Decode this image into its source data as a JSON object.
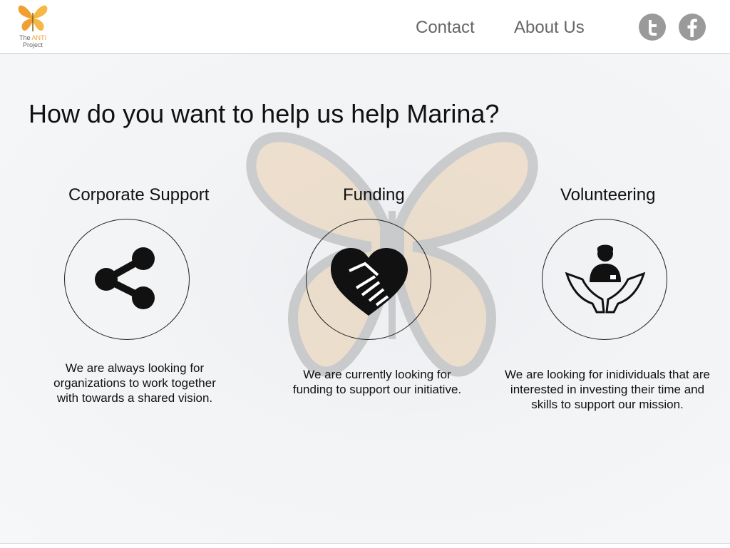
{
  "header": {
    "logo": {
      "line1_prefix": "The ",
      "line1_accent": "ANTI",
      "line2": "Project",
      "accent_color": "#f0a030"
    },
    "nav": [
      {
        "label": "Contact"
      },
      {
        "label": "About Us"
      }
    ],
    "social": [
      {
        "icon": "twitter-icon",
        "color": "#9a9a9a"
      },
      {
        "icon": "facebook-icon",
        "color": "#9a9a9a"
      }
    ]
  },
  "main": {
    "title": "How do you want to help us help Marina?",
    "cards": [
      {
        "title": "Corporate Support",
        "icon": "share-icon",
        "description": "We are always looking for organizations to work together with towards a shared vision."
      },
      {
        "title": "Funding",
        "icon": "handshake-heart-icon",
        "description": "We are currently looking for funding to support our initiative."
      },
      {
        "title": "Volunteering",
        "icon": "hands-person-icon",
        "description": "We are looking for inidividuals that are interested in investing their time and skills to support our mission."
      }
    ]
  }
}
